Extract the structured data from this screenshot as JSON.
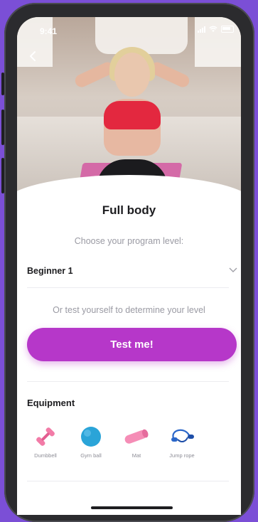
{
  "status_bar": {
    "time": "9:41"
  },
  "header": {
    "title": "Full body"
  },
  "program": {
    "prompt": "Choose your program level:",
    "selected_level": "Beginner 1",
    "test_hint": "Or test yourself to determine your level",
    "test_button_label": "Test me!"
  },
  "equipment": {
    "title": "Equipment",
    "items": [
      {
        "label": "Dumbbell",
        "icon": "dumbbell-icon",
        "color": "#f27ba7"
      },
      {
        "label": "Gym ball",
        "icon": "gym-ball-icon",
        "color": "#2aa4d8"
      },
      {
        "label": "Mat",
        "icon": "mat-icon",
        "color": "#f58db6"
      },
      {
        "label": "Jump rope",
        "icon": "jump-rope-icon",
        "color": "#2b67c9"
      }
    ]
  },
  "colors": {
    "accent": "#b637c9",
    "background": "#7b4fd6"
  }
}
